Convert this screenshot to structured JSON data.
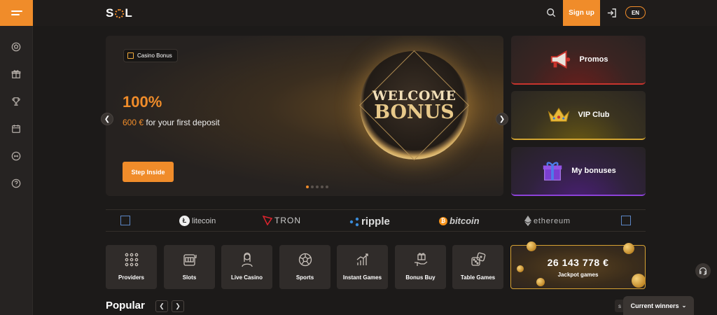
{
  "header": {
    "logo": "SOL",
    "signup_label": "Sign up",
    "lang": "EN"
  },
  "hero": {
    "tag": "Casino Bonus",
    "percent": "100%",
    "amount": "600 €",
    "subtitle": "for your first deposit",
    "cta": "Step Inside",
    "coin_line1": "WELCOME",
    "coin_line2": "BONUS",
    "active_slide": 1,
    "slide_count": 5
  },
  "promos": [
    {
      "label": "Promos",
      "icon": "megaphone-icon"
    },
    {
      "label": "VIP Club",
      "icon": "crown-icon"
    },
    {
      "label": "My bonuses",
      "icon": "gift-box-icon"
    }
  ],
  "crypto": [
    "litecoin",
    "TRON",
    "ripple",
    "bitcoin",
    "ethereum"
  ],
  "categories": [
    {
      "label": "Providers",
      "icon": "grid-dots-icon"
    },
    {
      "label": "Slots",
      "icon": "slot-machine-icon"
    },
    {
      "label": "Live Casino",
      "icon": "live-dealer-icon"
    },
    {
      "label": "Sports",
      "icon": "soccer-ball-icon"
    },
    {
      "label": "Instant Games",
      "icon": "bar-chart-icon"
    },
    {
      "label": "Bonus Buy",
      "icon": "hand-gift-icon"
    },
    {
      "label": "Table Games",
      "icon": "dice-icon"
    }
  ],
  "jackpot": {
    "amount": "26 143 778 €",
    "label": "Jackpot games"
  },
  "popular": {
    "title": "Popular"
  },
  "winners": {
    "label": "Current winners"
  },
  "colors": {
    "accent": "#f08c2a",
    "background": "#1c1a19",
    "tile": "#302c2a"
  }
}
